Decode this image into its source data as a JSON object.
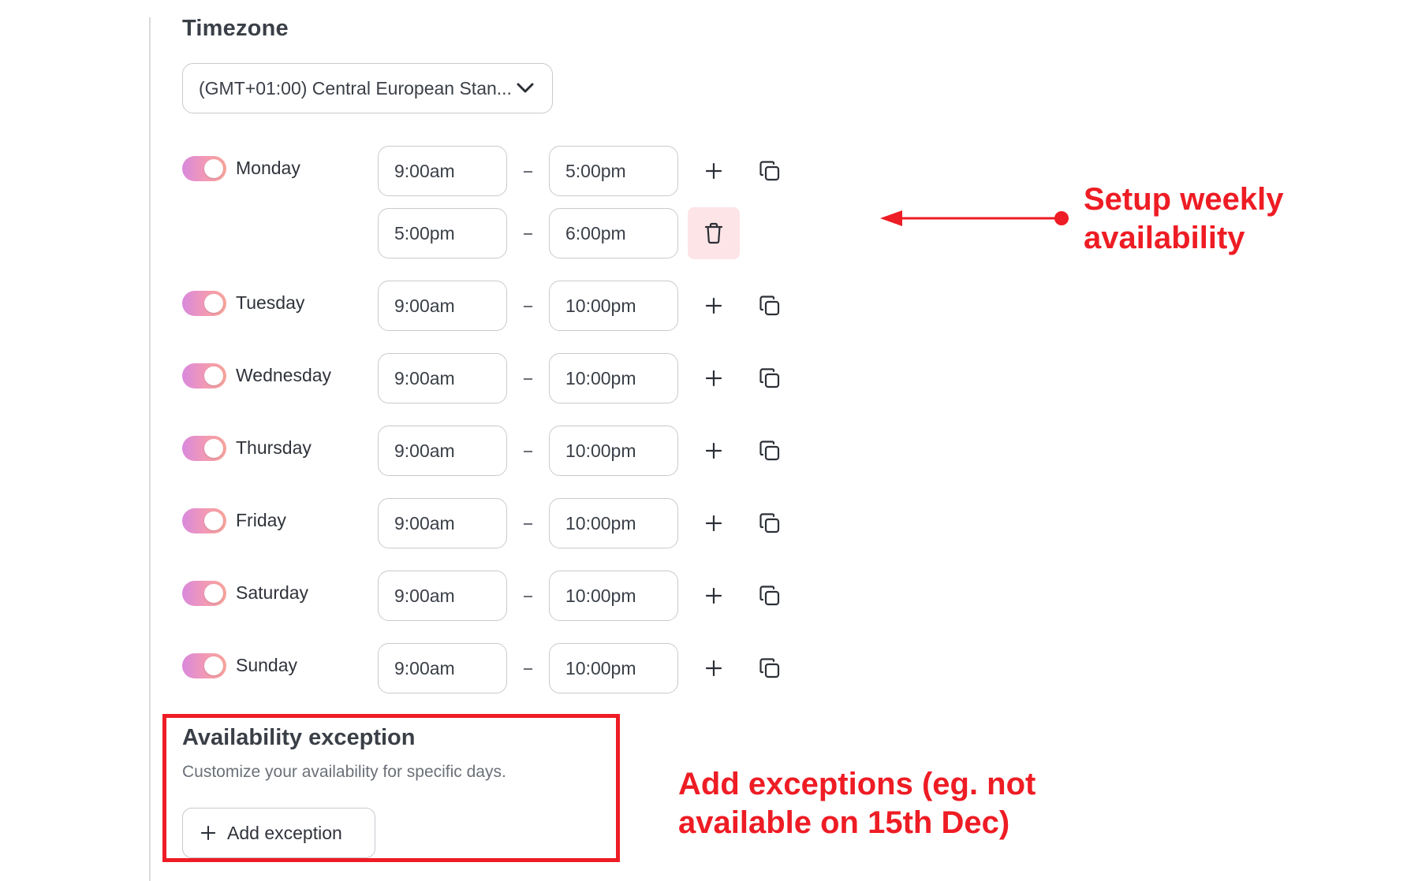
{
  "timezone": {
    "title": "Timezone",
    "selected": "(GMT+01:00) Central European Stan..."
  },
  "days": [
    {
      "name": "Monday",
      "enabled": true,
      "slots": [
        {
          "start": "9:00am",
          "end": "5:00pm"
        },
        {
          "start": "5:00pm",
          "end": "6:00pm"
        }
      ]
    },
    {
      "name": "Tuesday",
      "enabled": true,
      "slots": [
        {
          "start": "9:00am",
          "end": "10:00pm"
        }
      ]
    },
    {
      "name": "Wednesday",
      "enabled": true,
      "slots": [
        {
          "start": "9:00am",
          "end": "10:00pm"
        }
      ]
    },
    {
      "name": "Thursday",
      "enabled": true,
      "slots": [
        {
          "start": "9:00am",
          "end": "10:00pm"
        }
      ]
    },
    {
      "name": "Friday",
      "enabled": true,
      "slots": [
        {
          "start": "9:00am",
          "end": "10:00pm"
        }
      ]
    },
    {
      "name": "Saturday",
      "enabled": true,
      "slots": [
        {
          "start": "9:00am",
          "end": "10:00pm"
        }
      ]
    },
    {
      "name": "Sunday",
      "enabled": true,
      "slots": [
        {
          "start": "9:00am",
          "end": "10:00pm"
        }
      ]
    }
  ],
  "exception": {
    "title": "Availability exception",
    "description": "Customize your availability for specific days.",
    "add_button": "Add exception"
  },
  "annotations": {
    "weekly": "Setup weekly availability",
    "exceptions": "Add exceptions (eg. not available on 15th Dec)"
  },
  "icons": {
    "dropdown": "chevron-down-icon",
    "add": "plus-icon",
    "copy": "copy-icon",
    "delete": "trash-icon"
  },
  "colors": {
    "annotation": "#ee1c24",
    "toggle_start": "#d989dd",
    "toggle_end": "#f8a49a",
    "delete_bg": "#fde4e6"
  }
}
